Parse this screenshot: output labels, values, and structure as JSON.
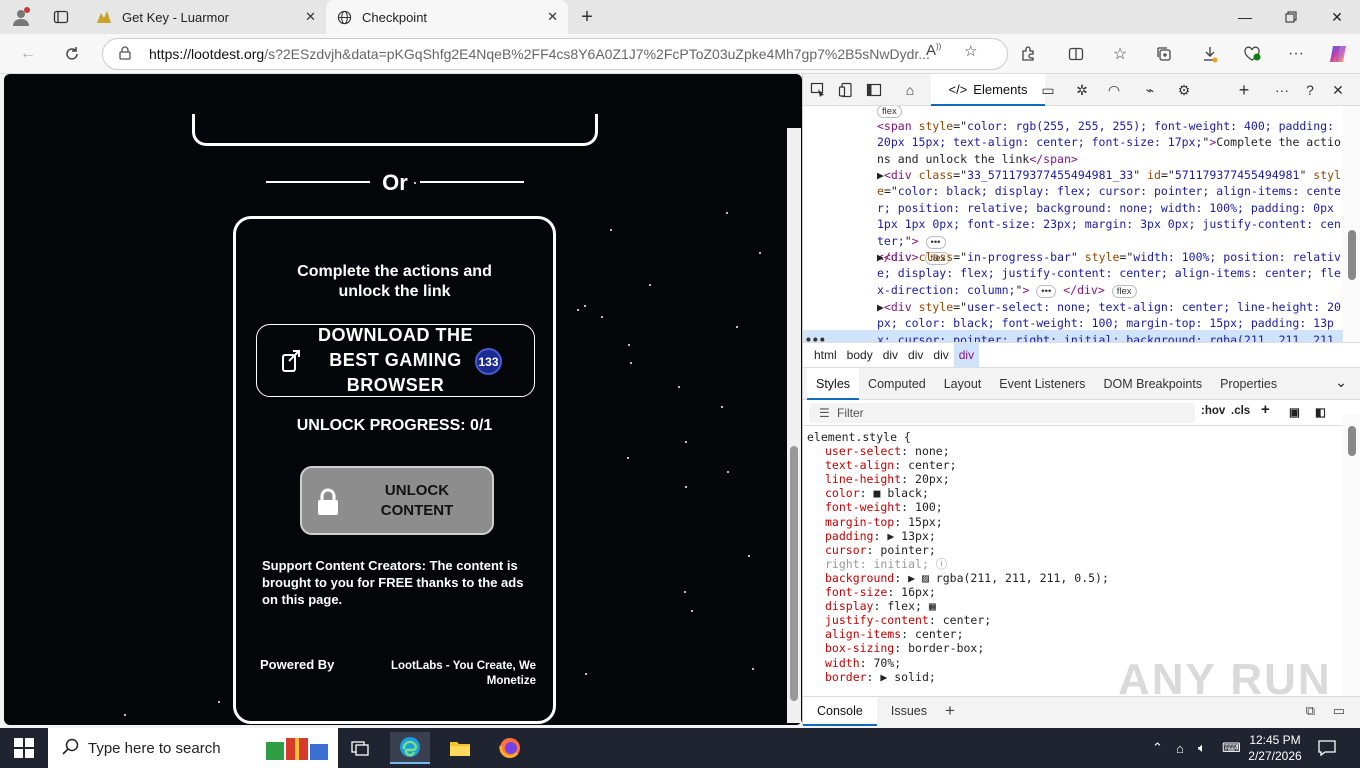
{
  "browser": {
    "tabs": [
      {
        "title": "Get Key - Luarmor",
        "active": false
      },
      {
        "title": "Checkpoint",
        "active": true
      }
    ],
    "url": {
      "host": "https://lootdest.org",
      "path": "/s?2ESzdvjh&data=pKGqShfg2E4NqeB%2FF4cs8Y6A0Z1J7%2FcPToZ03uZpke4Mh7gp7%2B5sNwDydr..."
    },
    "icons": [
      "profile-icon",
      "tab-actions-icon",
      "back-icon",
      "refresh-icon",
      "read-aloud-icon",
      "favorite-star-icon",
      "extensions-icon",
      "split-screen-icon",
      "favorites-icon",
      "collections-icon",
      "downloads-icon",
      "browser-essentials-icon",
      "more-icon",
      "copilot-icon"
    ]
  },
  "page": {
    "or_label": "Or",
    "card_title": "Complete the actions and unlock the link",
    "action": {
      "label": "DOWNLOAD THE BEST GAMING BROWSER",
      "badge": "133"
    },
    "progress": "UNLOCK PROGRESS: 0/1",
    "unlock_button": "UNLOCK CONTENT",
    "support_text": "Support Content Creators: The content is brought to you for FREE thanks to the ads on this page.",
    "powered_by": "Powered By",
    "lootlabs": "LootLabs - You Create, We Monetize"
  },
  "devtools": {
    "active_tab": "Elements",
    "dom_lines": [
      {
        "html": "<span class=\"pill\">flex</span>"
      },
      {
        "html": "<span class=\"tag\">&lt;span</span> <span class=\"attr\">style</span>=\"<span class=\"val\">color: rgb(255, 255, 255); font-weight: 400; padding: 20px 15px; text-align: center; font-size: 17px;</span>\"<span class=\"tag\">&gt;</span><span class=\"txt\">Complete the actions and unlock the link</span><span class=\"tag\">&lt;/span&gt;</span>"
      },
      {
        "html": "▶<span class=\"tag\">&lt;div</span> <span class=\"attr\">class</span>=\"<span class=\"val\">33_571179377455494981_33</span>\" <span class=\"attr\">id</span>=\"<span class=\"val\">571179377455494981</span>\" <span class=\"attr\">style</span>=\"<span class=\"val\">color: black; display: flex; cursor: pointer; align-items: center; position: relative; background: none; width: 100%; padding: 0px 1px 1px 0px; font-size: 23px; margin: 3px 0px; justify-content: center;</span>\"<span class=\"tag\">&gt;</span> <span class=\"pill\">•••</span><br><span class=\"tag\">&lt;/div&gt;</span> <span class=\"pill\">flex</span>"
      },
      {
        "html": "▶<span class=\"tag\">&lt;div</span> <span class=\"attr\">class</span>=\"<span class=\"val\">in-progress-bar</span>\" <span class=\"attr\">style</span>=\"<span class=\"val\">width: 100%; position: relative; display: flex; justify-content: center; align-items: center; flex-direction: column;</span>\"<span class=\"tag\">&gt;</span> <span class=\"pill\">•••</span> <span class=\"tag\">&lt;/div&gt;</span> <span class=\"pill\">flex</span>"
      },
      {
        "html": "▶<span class=\"tag\">&lt;div</span> <span class=\"attr\">style</span>=\"<span class=\"val\">user-select: none; text-align: center; line-height: 20px; color: black; font-weight: 100; margin-top: 15px; padding: 13px; cursor: pointer; right: initial; background: rgba(211, 211, 211, 0.5); font</span>"
      }
    ],
    "breadcrumbs": [
      "html",
      "body",
      "div",
      "div",
      "div",
      "div"
    ],
    "panel_tabs": [
      "Styles",
      "Computed",
      "Layout",
      "Event Listeners",
      "DOM Breakpoints",
      "Properties"
    ],
    "filter_placeholder": "Filter",
    "filter_buttons": [
      ":hov",
      ".cls"
    ],
    "element_style_selector": "element.style {",
    "declarations": [
      {
        "prop": "user-select",
        "value": "none;",
        "inactive": false
      },
      {
        "prop": "text-align",
        "value": "center;",
        "inactive": false
      },
      {
        "prop": "line-height",
        "value": "20px;",
        "inactive": false
      },
      {
        "prop": "color",
        "value": "■ black;",
        "inactive": false
      },
      {
        "prop": "font-weight",
        "value": "100;",
        "inactive": false
      },
      {
        "prop": "margin-top",
        "value": "15px;",
        "inactive": false
      },
      {
        "prop": "padding",
        "value": "▶ 13px;",
        "inactive": false
      },
      {
        "prop": "cursor",
        "value": "pointer;",
        "inactive": false
      },
      {
        "prop": "right",
        "value": "initial; ⓘ",
        "inactive": true
      },
      {
        "prop": "background",
        "value": "▶ ▨ rgba(211, 211, 211, 0.5);",
        "inactive": false
      },
      {
        "prop": "font-size",
        "value": "16px;",
        "inactive": false
      },
      {
        "prop": "display",
        "value": "flex; ▦",
        "inactive": false
      },
      {
        "prop": "justify-content",
        "value": "center;",
        "inactive": false
      },
      {
        "prop": "align-items",
        "value": "center;",
        "inactive": false
      },
      {
        "prop": "box-sizing",
        "value": "border-box;",
        "inactive": false
      },
      {
        "prop": "width",
        "value": "70%;",
        "inactive": false
      },
      {
        "prop": "border",
        "value": "▶ solid;",
        "inactive": false
      }
    ],
    "drawer_tabs": [
      "Console",
      "Issues"
    ]
  },
  "watermark": "ANY RUN",
  "taskbar": {
    "search_placeholder": "Type here to search",
    "time": "12:45 PM",
    "date": "2/27/2026"
  },
  "colors": {
    "page_bg": "#05060a",
    "unlock_button": "#8d8d8d",
    "badge": "#1b2a8f",
    "accent": "#0f6cbd"
  }
}
